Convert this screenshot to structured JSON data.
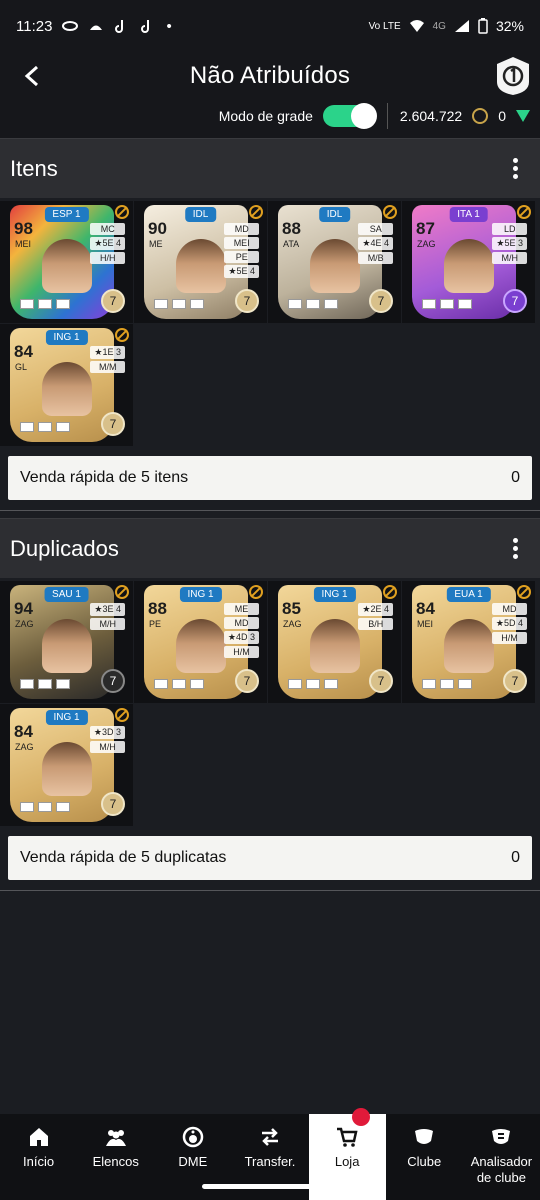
{
  "statusbar": {
    "time": "11:23",
    "dot": "•",
    "network": "Vo LTE",
    "signal": "4G",
    "battery": "32%"
  },
  "header": {
    "title": "Não Atribuídos"
  },
  "toolbar": {
    "grid_mode_label": "Modo de grade",
    "coins": "2.604.722",
    "points": "0"
  },
  "colors": {
    "toggle": "#2bd38a",
    "qs_bg": "#f4f4f2",
    "nav_active": "#ffffff",
    "badge": "#e01a3a"
  },
  "items": {
    "title": "Itens",
    "cards": [
      {
        "pill": "ESP 1",
        "ovr": "98",
        "pos": "MEI",
        "attrs": [
          "MC",
          "★5E 4",
          "H/H"
        ],
        "count": "7",
        "style": "multi"
      },
      {
        "pill": "IDL",
        "ovr": "90",
        "pos": "ME",
        "attrs": [
          "MD",
          "MEI",
          "PE",
          "★5E 4"
        ],
        "count": "7",
        "style": "icon"
      },
      {
        "pill": "IDL",
        "ovr": "88",
        "pos": "ATA",
        "attrs": [
          "SA",
          "★4E 4",
          "M/B"
        ],
        "count": "7",
        "style": "idl"
      },
      {
        "pill": "ITA 1",
        "ovr": "87",
        "pos": "ZAG",
        "attrs": [
          "LD",
          "★5E 3",
          "M/H"
        ],
        "count": "7",
        "style": "purple"
      },
      {
        "pill": "ING 1",
        "ovr": "84",
        "pos": "GL",
        "attrs": [
          "★1E 3",
          "M/M"
        ],
        "count": "7",
        "style": "gold"
      }
    ],
    "quick_sell_label": "Venda rápida de 5 itens",
    "quick_sell_value": "0"
  },
  "duplicates": {
    "title": "Duplicados",
    "cards": [
      {
        "pill": "SAU 1",
        "ovr": "94",
        "pos": "ZAG",
        "attrs": [
          "★3E 4",
          "M/H"
        ],
        "count": "7",
        "style": "dark"
      },
      {
        "pill": "ING 1",
        "ovr": "88",
        "pos": "PE",
        "attrs": [
          "ME",
          "MD",
          "★4D 3",
          "H/M"
        ],
        "count": "7",
        "style": "gold"
      },
      {
        "pill": "ING 1",
        "ovr": "85",
        "pos": "ZAG",
        "attrs": [
          "★2E 4",
          "B/H"
        ],
        "count": "7",
        "style": "gold"
      },
      {
        "pill": "EUA 1",
        "ovr": "84",
        "pos": "MEI",
        "attrs": [
          "MD",
          "★5D 4",
          "H/M"
        ],
        "count": "7",
        "style": "gold"
      },
      {
        "pill": "ING 1",
        "ovr": "84",
        "pos": "ZAG",
        "attrs": [
          "★3D 3",
          "M/H"
        ],
        "count": "7",
        "style": "gold"
      }
    ],
    "quick_sell_label": "Venda rápida de 5 duplicatas",
    "quick_sell_value": "0"
  },
  "nav": [
    {
      "label": "Início",
      "icon": "home-icon"
    },
    {
      "label": "Elencos",
      "icon": "squad-icon"
    },
    {
      "label": "DME",
      "icon": "dme-icon"
    },
    {
      "label": "Transfer.",
      "icon": "transfer-icon"
    },
    {
      "label": "Loja",
      "icon": "cart-icon"
    },
    {
      "label": "Clube",
      "icon": "club-icon"
    },
    {
      "label": "Analisador de clube",
      "icon": "analyzer-icon"
    }
  ]
}
